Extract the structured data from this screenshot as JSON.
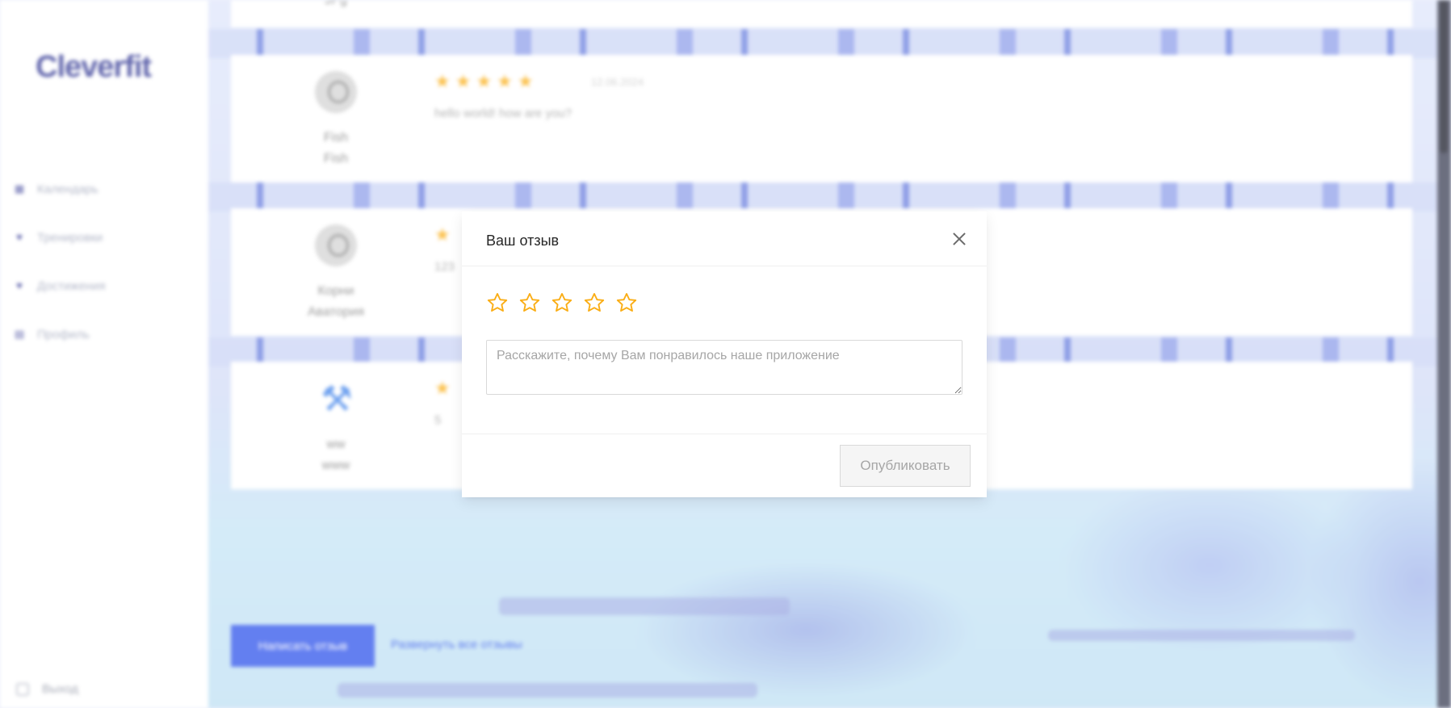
{
  "app": {
    "logo": "Cleverfit",
    "sidebar": {
      "items": [
        {
          "label": "Календарь",
          "icon": "calendar-icon"
        },
        {
          "label": "Тренировки",
          "icon": "heart-icon"
        },
        {
          "label": "Достижения",
          "icon": "trophy-icon"
        },
        {
          "label": "Профиль",
          "icon": "profile-icon"
        }
      ],
      "logout": {
        "label": "Выход",
        "icon": "logout-icon"
      }
    },
    "reviews": [
      {
        "first": "",
        "last": "JPg",
        "rating": 0,
        "date": "",
        "text": ""
      },
      {
        "first": "Fish",
        "last": "Fish",
        "rating": 5,
        "date": "12.06.2024",
        "text": "hello world! how are you?"
      },
      {
        "first": "Корни",
        "last": "Аватория",
        "rating": 1,
        "date": "",
        "text": "123"
      },
      {
        "first": "ww",
        "last": "www",
        "rating": 1,
        "date": "",
        "text": "5"
      }
    ],
    "write_review_button": "Написать отзыв",
    "expand_all_link": "Развернуть все отзывы"
  },
  "modal": {
    "title": "Ваш отзыв",
    "rating_value": 0,
    "rating_max": 5,
    "textarea": {
      "value": "",
      "placeholder": "Расскажите, почему Вам понравилось наше приложение"
    },
    "publish_button": "Опубликовать",
    "publish_disabled": true
  },
  "colors": {
    "accent": "#2f54eb",
    "star": "#faad14",
    "logo": "#2f3592"
  }
}
